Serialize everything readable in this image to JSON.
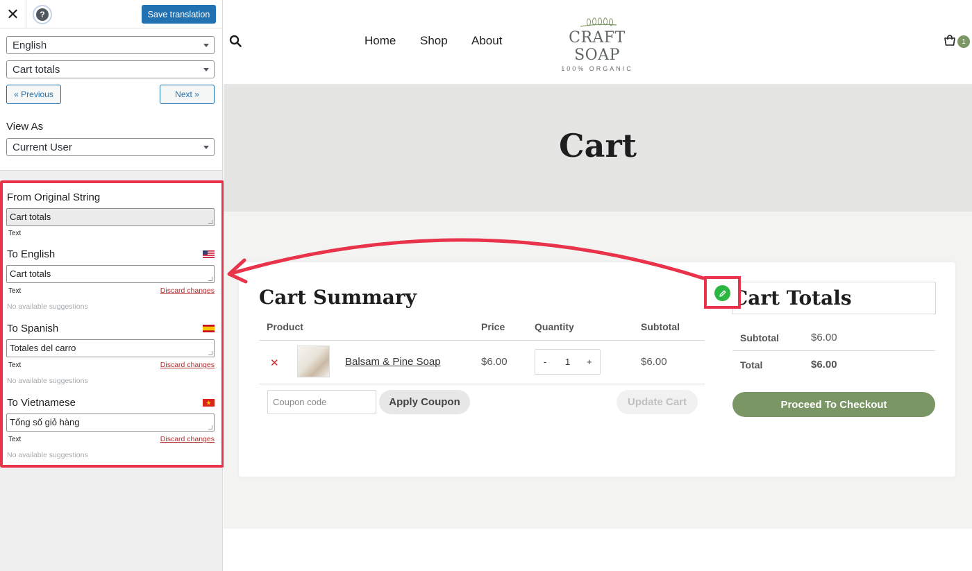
{
  "sidebar": {
    "close_icon": "close-icon",
    "help_icon": "?",
    "save_label": "Save translation",
    "language_select": "English",
    "string_select": "Cart totals",
    "previous_label": "« Previous",
    "next_label": "Next »",
    "view_as_label": "View As",
    "view_as_select": "Current User",
    "strings": {
      "original": {
        "heading": "From Original String",
        "value": "Cart totals",
        "type": "Text"
      },
      "translations": [
        {
          "heading": "To English",
          "value": "Cart totals",
          "type": "Text",
          "discard": "Discard changes",
          "suggestions": "No available suggestions",
          "flag": "us-flag"
        },
        {
          "heading": "To Spanish",
          "value": "Totales del carro",
          "type": "Text",
          "discard": "Discard changes",
          "suggestions": "No available suggestions",
          "flag": "es-flag"
        },
        {
          "heading": "To Vietnamese",
          "value": "Tổng số giỏ hàng",
          "type": "Text",
          "discard": "Discard changes",
          "suggestions": "No available suggestions",
          "flag": "vn-flag"
        }
      ]
    },
    "highlight_color": "#e8334a"
  },
  "site": {
    "menu": [
      "Home",
      "Shop",
      "About"
    ],
    "logo_title": "CRAFT SOAP",
    "logo_subtitle": "100% ORGANIC",
    "cart_count": "1",
    "page_title": "Cart",
    "summary": {
      "title": "Cart Summary",
      "headers": [
        "Product",
        "Price",
        "Quantity",
        "Subtotal"
      ],
      "item": {
        "name": "Balsam & Pine Soap",
        "price": "$6.00",
        "qty": "1",
        "minus": "-",
        "plus": "+",
        "subtotal": "$6.00"
      },
      "coupon_placeholder": "Coupon code",
      "apply_label": "Apply Coupon",
      "update_label": "Update Cart"
    },
    "totals": {
      "title": "Cart Totals",
      "subtotal_label": "Subtotal",
      "subtotal_value": "$6.00",
      "total_label": "Total",
      "total_value": "$6.00",
      "checkout_label": "Proceed To Checkout"
    },
    "accent_color": "#7a9664",
    "edit_marker_color": "#2bb741"
  }
}
